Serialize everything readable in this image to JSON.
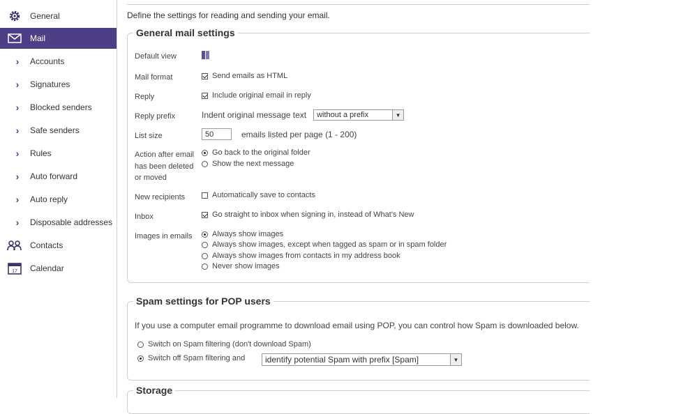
{
  "sidebar": {
    "items": [
      {
        "label": "General",
        "icon": "gear-icon"
      },
      {
        "label": "Mail",
        "icon": "envelope-icon"
      },
      {
        "label": "Accounts",
        "icon": "chevron-right-icon"
      },
      {
        "label": "Signatures",
        "icon": "chevron-right-icon"
      },
      {
        "label": "Blocked senders",
        "icon": "chevron-right-icon"
      },
      {
        "label": "Safe senders",
        "icon": "chevron-right-icon"
      },
      {
        "label": "Rules",
        "icon": "chevron-right-icon"
      },
      {
        "label": "Auto forward",
        "icon": "chevron-right-icon"
      },
      {
        "label": "Auto reply",
        "icon": "chevron-right-icon"
      },
      {
        "label": "Disposable addresses",
        "icon": "chevron-right-icon"
      },
      {
        "label": "Contacts",
        "icon": "contacts-icon"
      },
      {
        "label": "Calendar",
        "icon": "calendar-icon",
        "day": "17"
      }
    ],
    "active_color": "#4d3e85"
  },
  "intro": "Define the settings for reading and sending your email.",
  "general": {
    "title": "General mail settings",
    "default_view_label": "Default view",
    "mail_format_label": "Mail format",
    "mail_format_option": "Send emails as HTML",
    "reply_label": "Reply",
    "reply_option": "Include original email in reply",
    "reply_prefix_label": "Reply prefix",
    "reply_prefix_text": "Indent original message text",
    "reply_prefix_value": "without a prefix",
    "list_size_label": "List size",
    "list_size_value": "50",
    "list_size_suffix": "emails listed per page (1 - 200)",
    "action_label": "Action after email has been deleted or moved",
    "action_opt1": "Go back to the original folder",
    "action_opt2": "Show the next message",
    "new_recipients_label": "New recipients",
    "new_recipients_option": "Automatically save to contacts",
    "inbox_label": "Inbox",
    "inbox_option": "Go straight to inbox when signing in, instead of What's New",
    "images_label": "Images in emails",
    "images_opt1": "Always show images",
    "images_opt2": "Always show images, except when tagged as spam or in spam folder",
    "images_opt3": "Always show images from contacts in my address book",
    "images_opt4": "Never show images"
  },
  "spam": {
    "title": "Spam settings for POP users",
    "description": "If you use a computer email programme to download email using POP, you can control how Spam is downloaded below.",
    "opt1": "Switch on Spam filtering (don't download Spam)",
    "opt2": "Switch off Spam filtering and",
    "prefix_value": "identify potential Spam with prefix [Spam]"
  },
  "storage": {
    "title": "Storage"
  }
}
